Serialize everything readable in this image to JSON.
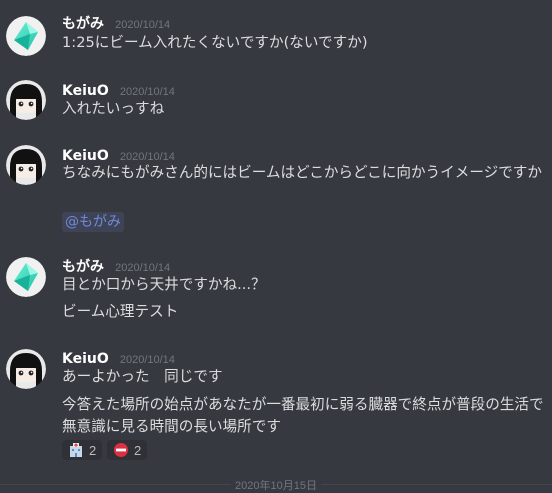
{
  "messages": [
    {
      "author": "もがみ",
      "timestamp": "2020/10/14",
      "lines": [
        "1:25にビーム入れたくないですか(ないですか)"
      ]
    },
    {
      "author": "KeiuO",
      "timestamp": "2020/10/14",
      "lines": [
        "入れたいっすね"
      ]
    },
    {
      "author": "KeiuO",
      "timestamp": "2020/10/14",
      "lines": [
        "ちなみにもがみさん的にはビームはどこからどこに向かうイメージですか"
      ],
      "mention": "@もがみ"
    },
    {
      "author": "もがみ",
      "timestamp": "2020/10/14",
      "lines": [
        "目とか口から天井ですかね...？",
        "ビーム心理テスト"
      ]
    },
    {
      "author": "KeiuO",
      "timestamp": "2020/10/14",
      "lines": [
        "あーよかった　同じです",
        "今答えた場所の始点があなたが一番最初に弱る臓器で終点が普段の生活で無意識に見る時間の長い場所です"
      ],
      "reactions": [
        {
          "icon": "hospital-icon",
          "count": "2"
        },
        {
          "icon": "no-entry-icon",
          "count": "2"
        }
      ]
    }
  ],
  "divider": {
    "label": "2020年10月15日"
  },
  "colors": {
    "background": "#36393f",
    "username": "#ffffff",
    "timestamp": "#72767d",
    "text": "#dcddde",
    "mention": "#7289da"
  }
}
